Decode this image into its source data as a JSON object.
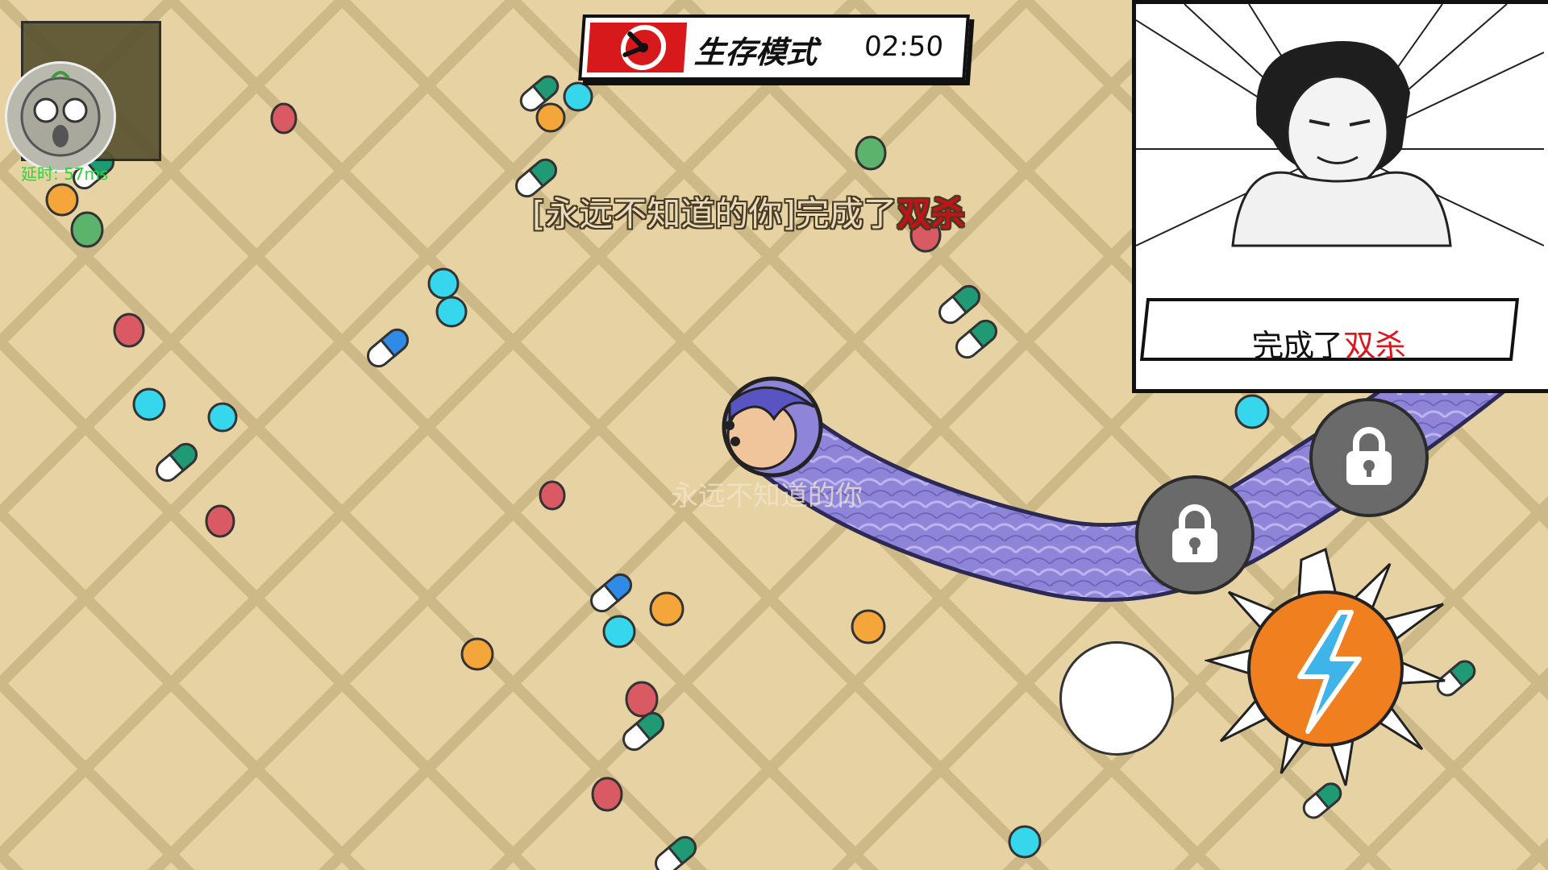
{
  "hud": {
    "mode_title": "生存模式",
    "timer": "02:50",
    "latency": "延时: 57ms"
  },
  "kill_feed": {
    "player": "[永远不知道的你]完成了",
    "event": "双杀"
  },
  "player": {
    "name": "永远不知道的你"
  },
  "meme_panel": {
    "caption_prefix": "完成了",
    "caption_highlight": "双杀"
  },
  "controls": {
    "skill_slot_1": "lock-icon",
    "skill_slot_2": "lock-icon",
    "boost": "lightning-icon",
    "joystick": "joystick"
  },
  "colors": {
    "background": "#e6d2a2",
    "grid": "#cdb887",
    "snake": "#8f85d8",
    "alert_red": "#d8191c"
  }
}
